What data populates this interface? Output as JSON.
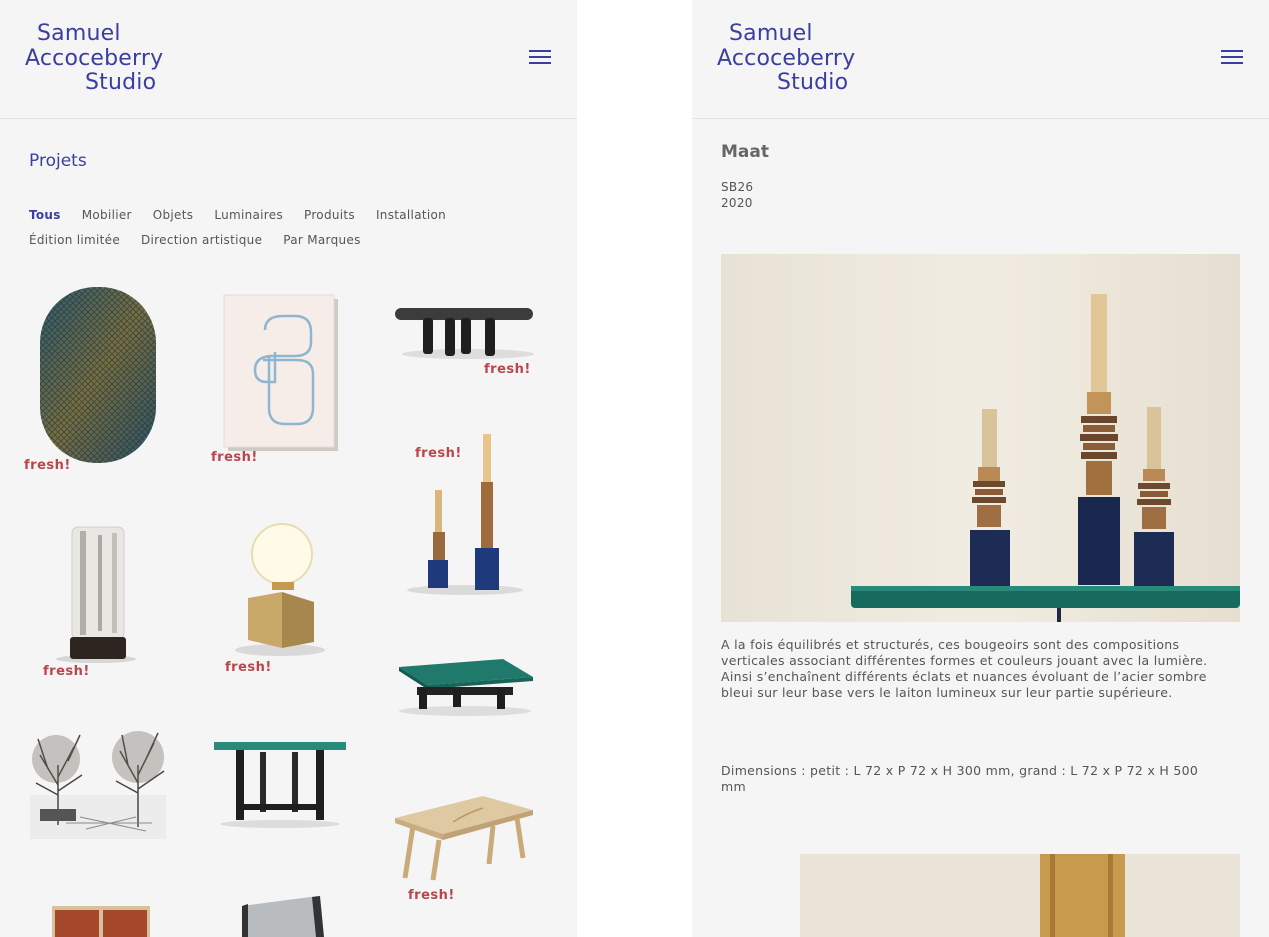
{
  "brand": {
    "line1": "Samuel",
    "line2": "Accoceberry",
    "line3": "Studio",
    "color": "#3a3ea0"
  },
  "menu_icon": "hamburger-menu-icon",
  "projects_page": {
    "title": "Projets",
    "filters": [
      "Tous",
      "Mobilier",
      "Objets",
      "Luminaires",
      "Produits",
      "Installation",
      "Édition limitée",
      "Direction artistique",
      "Par Marques"
    ],
    "active_filter": "Tous",
    "badge_label": "fresh!",
    "badge_color": "#b8464c",
    "thumbnails": [
      {
        "name": "woven-oval-mirror",
        "fresh": true
      },
      {
        "name": "framed-line-drawing",
        "fresh": true
      },
      {
        "name": "dark-low-table",
        "fresh": true
      },
      {
        "name": "candlesticks-maat",
        "fresh": true
      },
      {
        "name": "glass-column-lamp",
        "fresh": true
      },
      {
        "name": "globe-brass-lamp",
        "fresh": true
      },
      {
        "name": "green-top-coffee-table",
        "fresh": false
      },
      {
        "name": "trees-installation-sketch",
        "fresh": false
      },
      {
        "name": "green-console-table",
        "fresh": false
      },
      {
        "name": "wooden-desk",
        "fresh": true
      },
      {
        "name": "wood-panel-screen",
        "fresh": false
      },
      {
        "name": "grey-mirror-panel",
        "fresh": false
      }
    ]
  },
  "project_detail": {
    "title": "Maat",
    "reference": "SB26",
    "year": "2020",
    "description_1": "A la fois équilibrés et structurés, ces bougeoirs sont des compositions verticales associant différentes formes et couleurs jouant avec la lumière.",
    "description_2": "Ainsi s’enchaînent différents éclats et nuances évoluant de l’acier sombre bleui sur leur base vers le laiton lumineux sur leur partie supérieure.",
    "dimensions": "Dimensions : petit : L 72 x P 72 x H 300 mm, grand : L 72 x P 72 x H 500 mm"
  }
}
